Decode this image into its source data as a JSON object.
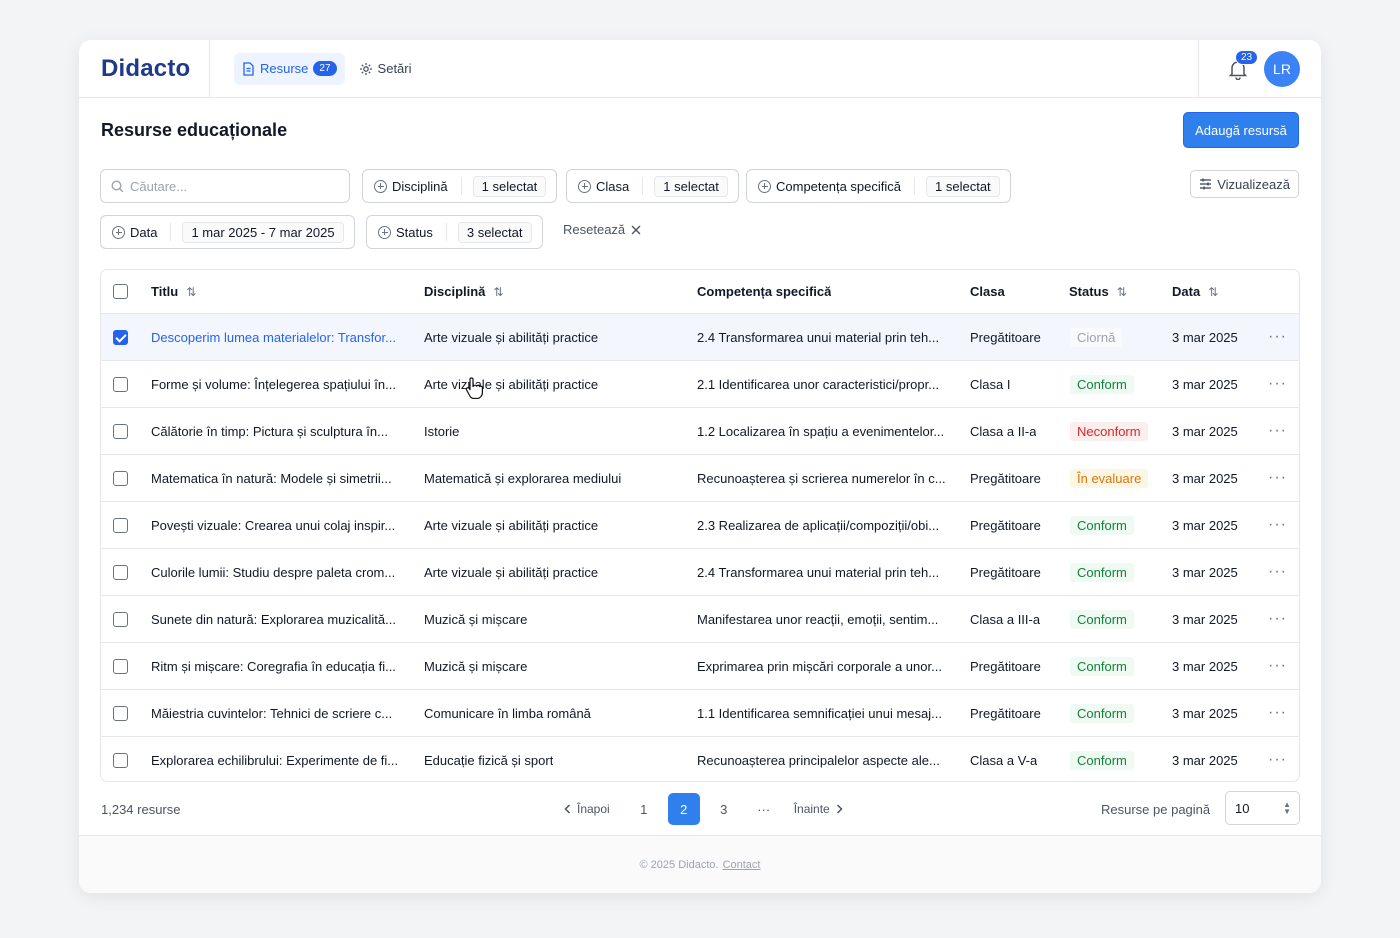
{
  "app": {
    "name": "Didacto",
    "nav": [
      {
        "label": "Resurse",
        "badge": "27",
        "icon": "document-icon"
      },
      {
        "label": "Setări",
        "icon": "gear-icon"
      }
    ],
    "notifications_count": "23",
    "avatar_initials": "LR"
  },
  "page": {
    "title": "Resurse educaționale",
    "add_button": "Adaugă resursă",
    "view_button": "Vizualizează"
  },
  "filters": {
    "search_placeholder": "Căutare...",
    "discipline": {
      "label": "Disciplină",
      "value": "1 selectat"
    },
    "class": {
      "label": "Clasa",
      "value": "1 selectat"
    },
    "competence": {
      "label": "Competența specifică",
      "value": "1 selectat"
    },
    "date": {
      "label": "Data",
      "value": "1 mar 2025 - 7 mar 2025"
    },
    "status": {
      "label": "Status",
      "value": "3 selectat"
    },
    "reset": "Resetează"
  },
  "table": {
    "headers": {
      "title": "Titlu",
      "discipline": "Disciplină",
      "competence": "Competența specifică",
      "class": "Clasa",
      "status": "Status",
      "date": "Data"
    },
    "rows": [
      {
        "title": "Descoperim lumea materialelor: Transfor...",
        "discipline": "Arte vizuale și abilități practice",
        "competence": "2.4 Transformarea unui material prin teh...",
        "class": "Pregătitoare",
        "status": "Ciornă",
        "status_type": "draft",
        "date": "3 mar 2025",
        "selected": true
      },
      {
        "title": "Forme și volume: Înțelegerea spațiului în...",
        "discipline": "Arte vizuale și abilități practice",
        "competence": "2.1 Identificarea unor caracteristici/propr...",
        "class": "Clasa I",
        "status": "Conform",
        "status_type": "ok",
        "date": "3 mar 2025",
        "selected": false
      },
      {
        "title": "Călătorie în timp: Pictura și sculptura în...",
        "discipline": "Istorie",
        "competence": "1.2 Localizarea în spațiu a evenimentelor...",
        "class": "Clasa a II-a",
        "status": "Neconform",
        "status_type": "bad",
        "date": "3 mar 2025",
        "selected": false
      },
      {
        "title": "Matematica în natură: Modele și simetrii...",
        "discipline": "Matematică și explorarea mediului",
        "competence": "Recunoașterea și scrierea numerelor în c...",
        "class": "Pregătitoare",
        "status": "În evaluare",
        "status_type": "eval",
        "date": "3 mar 2025",
        "selected": false
      },
      {
        "title": "Povești vizuale: Crearea unui colaj inspir...",
        "discipline": "Arte vizuale și abilități practice",
        "competence": "2.3 Realizarea de aplicații/compoziții/obi...",
        "class": "Pregătitoare",
        "status": "Conform",
        "status_type": "ok",
        "date": "3 mar 2025",
        "selected": false
      },
      {
        "title": "Culorile lumii: Studiu despre paleta crom...",
        "discipline": "Arte vizuale și abilități practice",
        "competence": "2.4 Transformarea unui material prin teh...",
        "class": "Pregătitoare",
        "status": "Conform",
        "status_type": "ok",
        "date": "3 mar 2025",
        "selected": false
      },
      {
        "title": "Sunete din natură: Explorarea muzicalită...",
        "discipline": "Muzică și mișcare",
        "competence": "Manifestarea unor reacții, emoții, sentim...",
        "class": "Clasa a III-a",
        "status": "Conform",
        "status_type": "ok",
        "date": "3 mar 2025",
        "selected": false
      },
      {
        "title": "Ritm și mișcare: Coregrafia în educația fi...",
        "discipline": "Muzică și mișcare",
        "competence": "Exprimarea prin mișcări corporale a unor...",
        "class": "Pregătitoare",
        "status": "Conform",
        "status_type": "ok",
        "date": "3 mar 2025",
        "selected": false
      },
      {
        "title": "Măiestria cuvintelor: Tehnici de scriere c...",
        "discipline": "Comunicare în limba română",
        "competence": "1.1 Identificarea semnificației unui mesaj...",
        "class": "Pregătitoare",
        "status": "Conform",
        "status_type": "ok",
        "date": "3 mar 2025",
        "selected": false
      },
      {
        "title": "Explorarea echilibrului: Experimente de fi...",
        "discipline": "Educație fizică și sport",
        "competence": "Recunoașterea principalelor aspecte ale...",
        "class": "Clasa a V-a",
        "status": "Conform",
        "status_type": "ok",
        "date": "3 mar 2025",
        "selected": false
      }
    ]
  },
  "pagination": {
    "total": "1,234 resurse",
    "prev": "Înapoi",
    "next": "Înainte",
    "pages": [
      "1",
      "2",
      "3"
    ],
    "ellipsis": "···",
    "current": "2",
    "per_page_label": "Resurse pe pagină",
    "per_page_value": "10"
  },
  "footer": {
    "copyright": "© 2025 Didacto.",
    "contact": "Contact"
  },
  "colors": {
    "primary": "#2f80ed",
    "brand": "#1e3a8a",
    "success": "#15803d",
    "danger": "#dc2626",
    "warning": "#d97706"
  }
}
